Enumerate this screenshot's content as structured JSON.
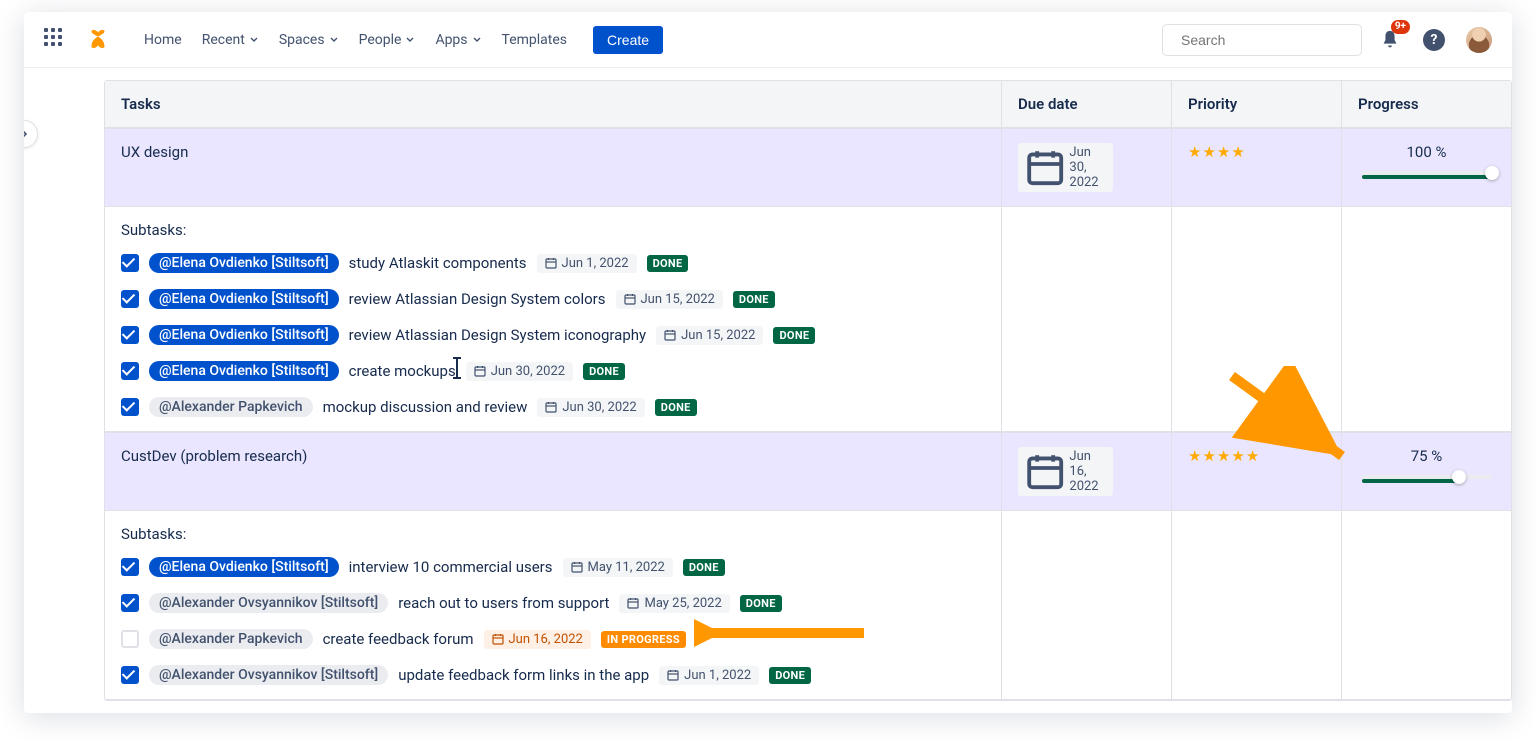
{
  "nav": {
    "items": [
      {
        "label": "Home",
        "dropdown": false
      },
      {
        "label": "Recent",
        "dropdown": true
      },
      {
        "label": "Spaces",
        "dropdown": true
      },
      {
        "label": "People",
        "dropdown": true
      },
      {
        "label": "Apps",
        "dropdown": true
      },
      {
        "label": "Templates",
        "dropdown": false
      }
    ],
    "create_label": "Create",
    "search_placeholder": "Search",
    "notification_badge": "9+"
  },
  "table": {
    "headers": {
      "tasks": "Tasks",
      "due": "Due date",
      "priority": "Priority",
      "progress": "Progress"
    },
    "sections": [
      {
        "title": "UX design",
        "due": "Jun 30, 2022",
        "stars": 4,
        "progress": "100 %",
        "progress_pct": 100,
        "subtasks_label": "Subtasks:",
        "subtasks": [
          {
            "checked": true,
            "mention": "@Elena Ovdienko [Stiltsoft]",
            "mention_style": "blue",
            "text": "study Atlaskit components",
            "date": "Jun 1, 2022",
            "date_style": "grey",
            "status": "DONE",
            "status_style": "done"
          },
          {
            "checked": true,
            "mention": "@Elena Ovdienko [Stiltsoft]",
            "mention_style": "blue",
            "text": "review Atlassian Design System colors",
            "date": "Jun 15, 2022",
            "date_style": "grey",
            "status": "DONE",
            "status_style": "done"
          },
          {
            "checked": true,
            "mention": "@Elena Ovdienko [Stiltsoft]",
            "mention_style": "blue",
            "text": "review Atlassian Design System iconography",
            "date": "Jun 15, 2022",
            "date_style": "grey",
            "status": "DONE",
            "status_style": "done"
          },
          {
            "checked": true,
            "mention": "@Elena Ovdienko [Stiltsoft]",
            "mention_style": "blue",
            "text": "create mockups",
            "date": "Jun 30, 2022",
            "date_style": "grey",
            "status": "DONE",
            "status_style": "done"
          },
          {
            "checked": true,
            "mention": "@Alexander Papkevich",
            "mention_style": "grey",
            "text": "mockup discussion and review",
            "date": "Jun 30, 2022",
            "date_style": "grey",
            "status": "DONE",
            "status_style": "done"
          }
        ]
      },
      {
        "title": "CustDev (problem research)",
        "due": "Jun 16, 2022",
        "stars": 5,
        "progress": "75 %",
        "progress_pct": 75,
        "subtasks_label": "Subtasks:",
        "subtasks": [
          {
            "checked": true,
            "mention": "@Elena Ovdienko [Stiltsoft]",
            "mention_style": "blue",
            "text": "interview 10 commercial users",
            "date": "May 11, 2022",
            "date_style": "grey",
            "status": "DONE",
            "status_style": "done"
          },
          {
            "checked": true,
            "mention": "@Alexander Ovsyannikov [Stiltsoft]",
            "mention_style": "grey",
            "text": "reach out to users from support",
            "date": "May 25, 2022",
            "date_style": "grey",
            "status": "DONE",
            "status_style": "done"
          },
          {
            "checked": false,
            "mention": "@Alexander Papkevich",
            "mention_style": "grey",
            "text": "create feedback forum",
            "date": "Jun 16, 2022",
            "date_style": "orange",
            "status": "IN PROGRESS",
            "status_style": "progress"
          },
          {
            "checked": true,
            "mention": "@Alexander Ovsyannikov [Stiltsoft]",
            "mention_style": "grey",
            "text": "update feedback form links in the app",
            "date": "Jun 1, 2022",
            "date_style": "grey",
            "status": "DONE",
            "status_style": "done"
          }
        ]
      }
    ]
  }
}
